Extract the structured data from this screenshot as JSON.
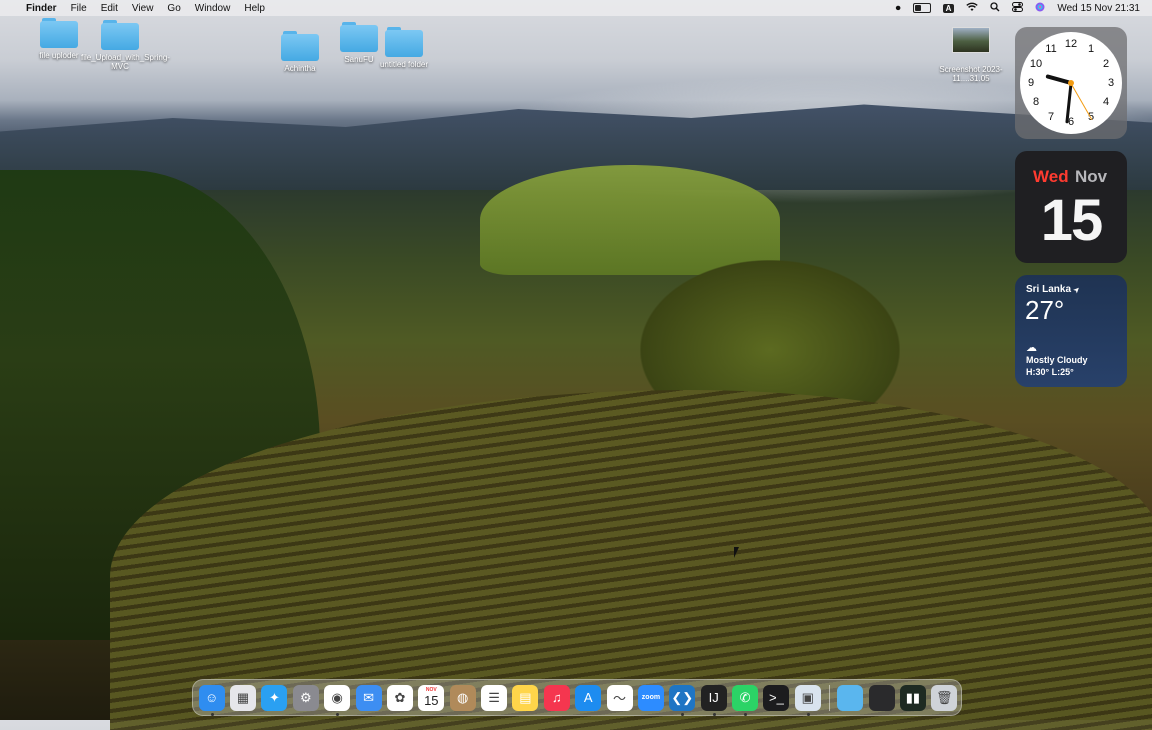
{
  "menubar": {
    "app_name": "Finder",
    "menus": [
      "File",
      "Edit",
      "View",
      "Go",
      "Window",
      "Help"
    ],
    "input_source": "A",
    "datetime": "Wed 15 Nov  21:31"
  },
  "desktop_icons": [
    {
      "label": "file uploder"
    },
    {
      "label": "file_Upload_with_Spring-MVC"
    },
    {
      "label": "Achintha"
    },
    {
      "label": "SanuFU"
    },
    {
      "label": "untitled folder"
    },
    {
      "label": "Screenshot 2023-11....31.05"
    }
  ],
  "clock_widget": {
    "numbers": [
      "12",
      "1",
      "2",
      "3",
      "4",
      "5",
      "6",
      "7",
      "8",
      "9",
      "10",
      "11"
    ],
    "time": "21:31"
  },
  "date_widget": {
    "weekday": "Wed",
    "month": "Nov",
    "day": "15"
  },
  "weather_widget": {
    "location": "Sri Lanka",
    "location_icon": "➤",
    "temperature": "27°",
    "cloud_icon": "☁",
    "condition": "Mostly Cloudy",
    "high_low": "H:30° L:25°"
  },
  "dock": {
    "apps": [
      {
        "name": "Finder",
        "glyph": "☺",
        "color": "#2f8df0",
        "running": true
      },
      {
        "name": "Launchpad",
        "glyph": "▦",
        "color": "#e6e6ea",
        "running": false
      },
      {
        "name": "Safari",
        "glyph": "✦",
        "color": "#2aa0f2",
        "running": false
      },
      {
        "name": "System Settings",
        "glyph": "⚙",
        "color": "#8a8a90",
        "running": false
      },
      {
        "name": "Google Chrome",
        "glyph": "◉",
        "color": "#ffffff",
        "running": true
      },
      {
        "name": "Mail",
        "glyph": "✉",
        "color": "#3d8ef2",
        "running": false
      },
      {
        "name": "Photos",
        "glyph": "✿",
        "color": "#ffffff",
        "running": false
      },
      {
        "name": "Calendar",
        "glyph": "",
        "color": "#ffffff",
        "running": false,
        "cal_month": "NOV",
        "cal_day": "15"
      },
      {
        "name": "Contacts",
        "glyph": "◍",
        "color": "#b08a5a",
        "running": false
      },
      {
        "name": "Reminders",
        "glyph": "☰",
        "color": "#ffffff",
        "running": false
      },
      {
        "name": "Notes",
        "glyph": "▤",
        "color": "#ffd54a",
        "running": false
      },
      {
        "name": "Music",
        "glyph": "♫",
        "color": "#f5364f",
        "running": false
      },
      {
        "name": "App Store",
        "glyph": "A",
        "color": "#1d8cf0",
        "running": false
      },
      {
        "name": "Freeform",
        "glyph": "〜",
        "color": "#ffffff",
        "running": false
      },
      {
        "name": "Zoom",
        "glyph": "zoom",
        "color": "#2d8cff",
        "running": false
      },
      {
        "name": "Visual Studio Code",
        "glyph": "❮❯",
        "color": "#1f75c4",
        "running": true
      },
      {
        "name": "IntelliJ IDEA",
        "glyph": "IJ",
        "color": "#222222",
        "running": true
      },
      {
        "name": "WhatsApp",
        "glyph": "✆",
        "color": "#2bd366",
        "running": true
      },
      {
        "name": "Terminal",
        "glyph": ">_",
        "color": "#1c1c1e",
        "running": false
      },
      {
        "name": "Preview",
        "glyph": "▣",
        "color": "#d9e3ee",
        "running": true
      }
    ],
    "right_items": [
      {
        "name": "Downloads Folder",
        "glyph": "",
        "color": "#5ab6ee"
      },
      {
        "name": "Minimized Window",
        "glyph": "",
        "color": "#2a2a2c"
      },
      {
        "name": "Activity Monitor",
        "glyph": "▮▮",
        "color": "#1e2a22"
      },
      {
        "name": "Trash",
        "glyph": "🗑",
        "color": "#cfd3d8"
      }
    ]
  }
}
